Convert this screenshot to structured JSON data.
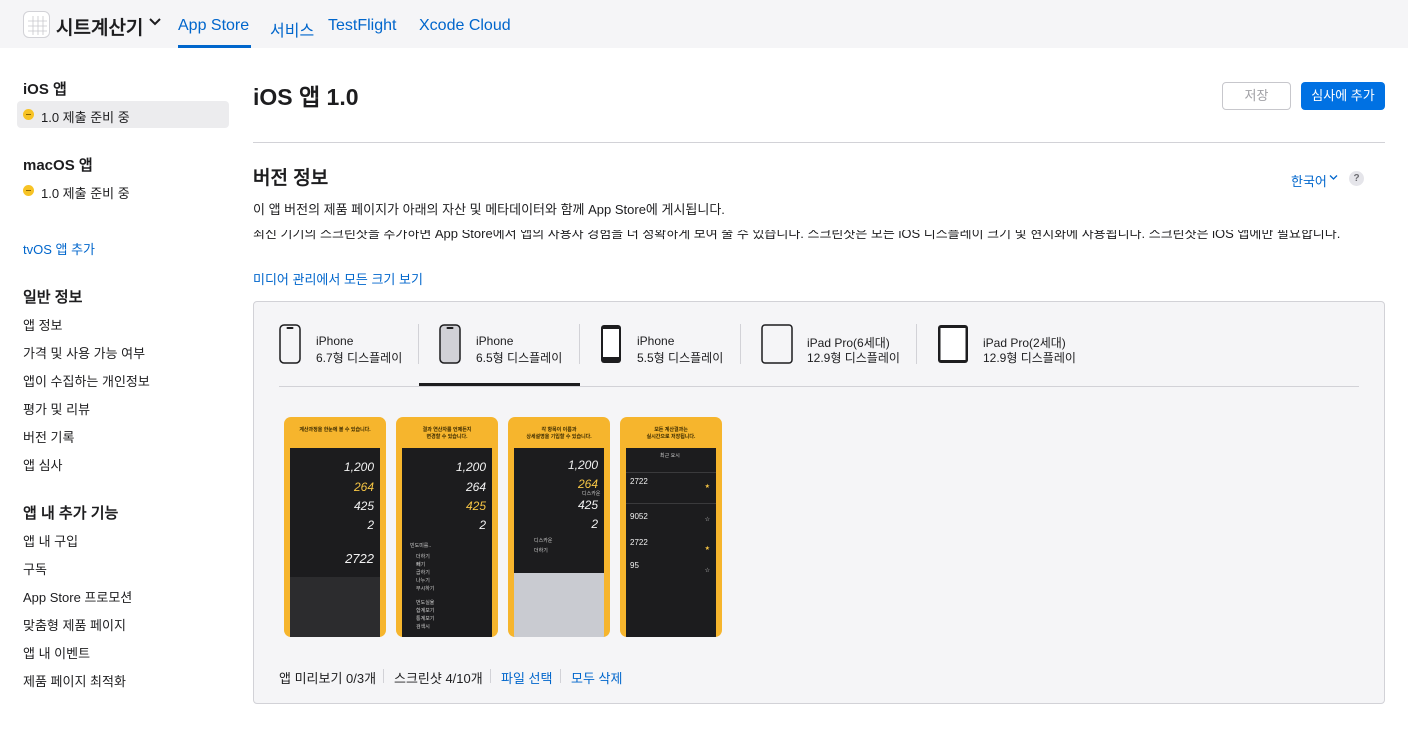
{
  "app": {
    "name": "시트계산기",
    "icon": "grid-app-icon"
  },
  "topnav": {
    "items": [
      "App Store",
      "서비스",
      "TestFlight",
      "Xcode Cloud"
    ],
    "active": "App Store"
  },
  "sidebar": {
    "ios_section": "iOS 앱",
    "ios_version": "1.0 제출 준비 중",
    "macos_section": "macOS 앱",
    "macos_version": "1.0 제출 준비 중",
    "add_tvos": "tvOS 앱 추가",
    "general_section": "일반 정보",
    "general_items": [
      "앱 정보",
      "가격 및 사용 가능 여부",
      "앱이 수집하는 개인정보",
      "평가 및 리뷰",
      "버전 기록",
      "앱 심사"
    ],
    "iap_section": "앱 내 추가 기능",
    "iap_items": [
      "앱 내 구입",
      "구독",
      "App Store 프로모션",
      "맞춤형 제품 페이지",
      "앱 내 이벤트",
      "제품 페이지 최적화"
    ],
    "status_color": "#f7c325"
  },
  "header": {
    "title": "iOS 앱 1.0",
    "save_label": "저장",
    "submit_label": "심사에 추가"
  },
  "version_info": {
    "title": "버전 정보",
    "language": "한국어",
    "help": "?",
    "description": "이 앱 버전의 제품 페이지가 아래의 자산 및 메타데이터와 함께 App Store에 게시됩니다.",
    "screenshot_note": "최신 기기의 스크린샷을 추가하면 App Store에서 앱의 사용자 경험을 더 정확하게 보여 줄 수 있습니다. 스크린샷은 모든 iOS 디스플레이 크기 및 현지화에 사용됩니다. 스크린샷은 iOS 앱에만 필요합니다.",
    "media_link": "미디어 관리에서 모든 크기 보기"
  },
  "device_tabs": [
    {
      "line1": "iPhone",
      "line2": "6.7형 디스플레이"
    },
    {
      "line1": "iPhone",
      "line2": "6.5형 디스플레이",
      "active": true
    },
    {
      "line1": "iPhone",
      "line2": "5.5형 디스플레이"
    },
    {
      "line1": "iPad Pro(6세대)",
      "line2": "12.9형 디스플레이"
    },
    {
      "line1": "iPad Pro(2세대)",
      "line2": "12.9형 디스플레이"
    }
  ],
  "screenshots": [
    {
      "caption": "계산과정을 한눈에 볼 수 있습니다.",
      "values": [
        "1,200",
        "264",
        "425",
        "2",
        "2722"
      ]
    },
    {
      "caption": "결과 연산자를 언제든지\n변경할 수 있습니다.",
      "values": [
        "1,200",
        "264",
        "425",
        "2"
      ],
      "menu": [
        "빈도미를..",
        "더하기",
        "빼기",
        "곱하기",
        "나누기",
        "무시하기",
        "번도실율",
        "합계보기",
        "통계보기",
        "검색시"
      ]
    },
    {
      "caption": "각 항목이 이름과\n상세설명을 기입할 수 있습니다.",
      "values": [
        "1,200",
        "264",
        "425",
        "2"
      ],
      "sub": "디스카운",
      "menu": [
        "디스카운",
        "더하기"
      ]
    },
    {
      "caption": "모든 계산결과는\n실시간으로 저장됩니다.",
      "header": "최근 요시",
      "list": [
        "2722",
        "9052",
        "2722",
        "95"
      ]
    }
  ],
  "footer": {
    "preview": "앱 미리보기 0/3개",
    "screenshots": "스크린샷 4/10개",
    "choose_file": "파일 선택",
    "delete_all": "모두 삭제"
  },
  "colors": {
    "accent": "#0071e3",
    "link": "#0066cc",
    "shot_bg": "#f6b52d"
  }
}
